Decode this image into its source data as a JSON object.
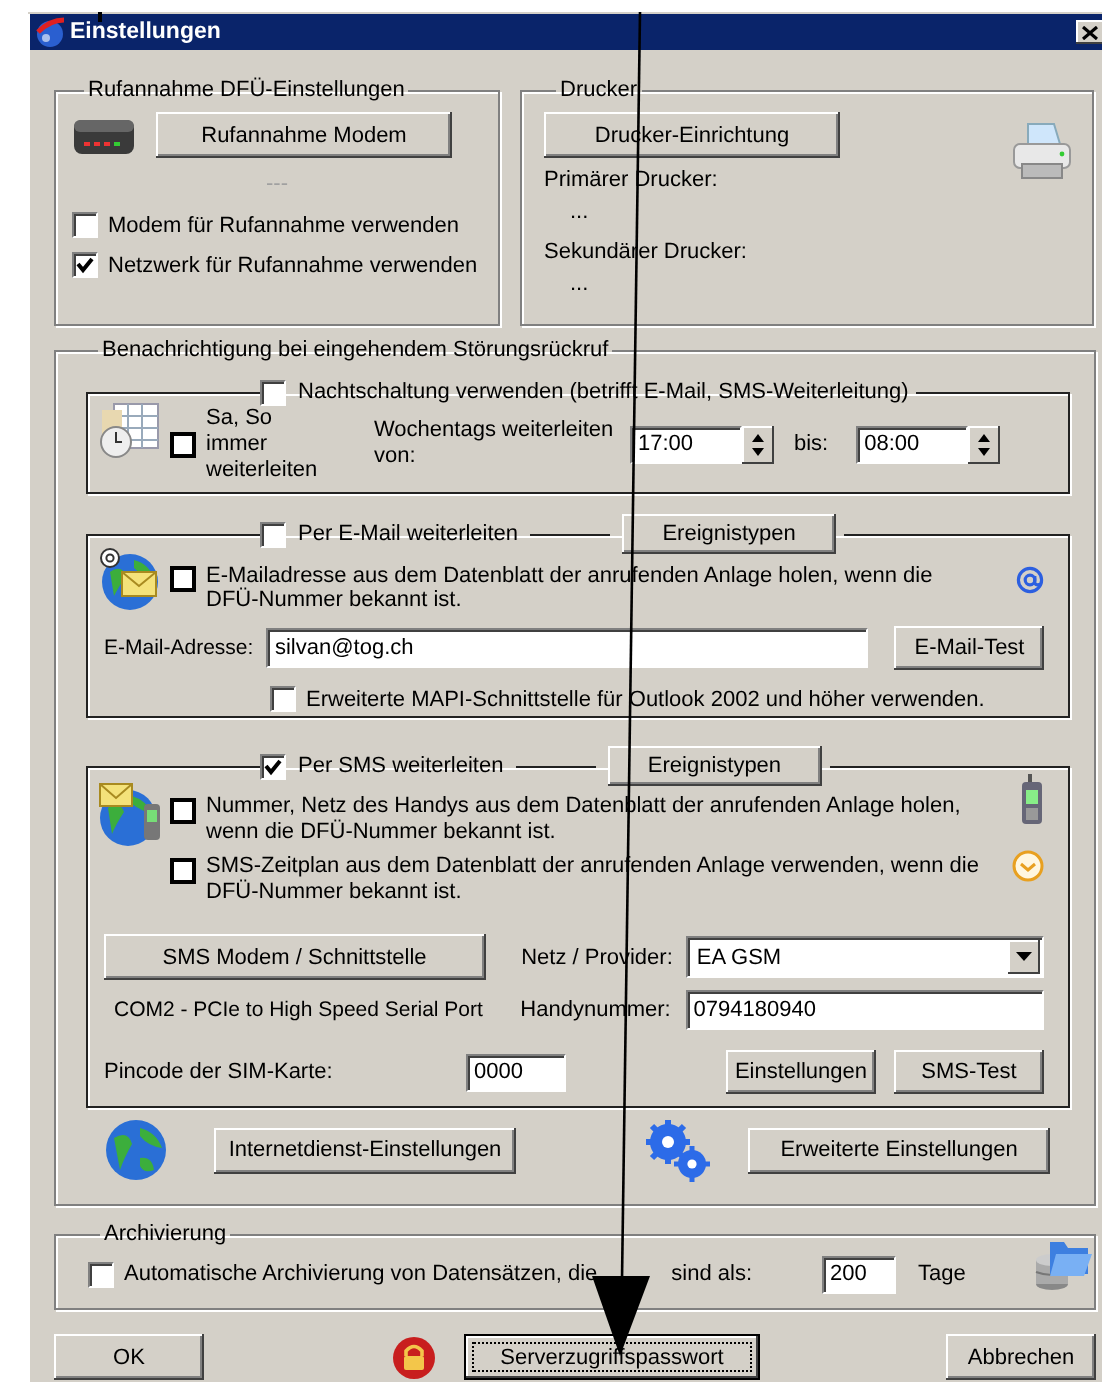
{
  "window": {
    "title": "Einstellungen"
  },
  "dial_in": {
    "title": "Rufannahme DFÜ-Einstellungen",
    "button": "Rufannahme Modem",
    "status": "---",
    "options": [
      {
        "label": "Modem für Rufannahme verwenden",
        "checked": false
      },
      {
        "label": "Netzwerk für Rufannahme verwenden",
        "checked": true
      }
    ]
  },
  "printer": {
    "title": "Drucker",
    "button": "Drucker-Einrichtung",
    "primary_label": "Primärer Drucker:",
    "primary_value": "...",
    "secondary_label": "Sekundärer Drucker:",
    "secondary_value": "..."
  },
  "notification": {
    "title": "Benachrichtigung bei eingehendem Störungsrückruf",
    "night": {
      "label": "Nachtschaltung verwenden (betrifft E-Mail, SMS-Weiterleitung)",
      "checked": false,
      "weekend_label": "Sa, So immer weiterleiten",
      "weekend_checked": false,
      "weekday_label": "Wochentags weiterleiten von:",
      "from": "17:00",
      "to_label": "bis:",
      "to": "08:00"
    },
    "email": {
      "label": "Per E-Mail weiterleiten",
      "checked": false,
      "events_button": "Ereignistypen",
      "from_sheet_label": "E-Mailadresse aus dem Datenblatt der anrufenden Anlage holen, wenn die DFÜ-Nummer bekannt ist.",
      "from_sheet_checked": false,
      "address_label": "E-Mail-Adresse:",
      "address": "silvan@tog.ch",
      "test_button": "E-Mail-Test",
      "mapi_label": "Erweiterte MAPI-Schnittstelle für Outlook 2002 und höher verwenden.",
      "mapi_checked": false
    },
    "sms": {
      "label": "Per SMS weiterleiten",
      "checked": true,
      "events_button": "Ereignistypen",
      "options": [
        {
          "label": "Nummer, Netz des Handys aus dem Datenblatt der anrufenden Anlage holen, wenn die DFÜ-Nummer bekannt ist.",
          "checked": false
        },
        {
          "label": "SMS-Zeitplan aus dem Datenblatt der anrufenden Anlage verwenden, wenn die DFÜ-Nummer bekannt ist.",
          "checked": false
        }
      ],
      "modem_button": "SMS Modem / Schnittstelle",
      "port": "COM2 - PCIe to High Speed Serial Port",
      "provider_label": "Netz / Provider:",
      "provider": "EA GSM",
      "phone_label": "Handynummer:",
      "phone": "0794180940",
      "pin_label": "Pincode der SIM-Karte:",
      "pin": "0000",
      "settings_button": "Einstellungen",
      "test_button": "SMS-Test"
    },
    "internet_button": "Internetdienst-Einstellungen",
    "advanced_button": "Erweiterte Einstellungen"
  },
  "archive": {
    "title": "Archivierung",
    "checked": false,
    "label_start": "Automatische Archivierung von Datensätzen, die",
    "label_end": "sind als:",
    "days": "200",
    "days_unit": "Tage"
  },
  "buttons": {
    "ok": "OK",
    "password": "Serverzugriffspasswort",
    "cancel": "Abbrechen"
  }
}
